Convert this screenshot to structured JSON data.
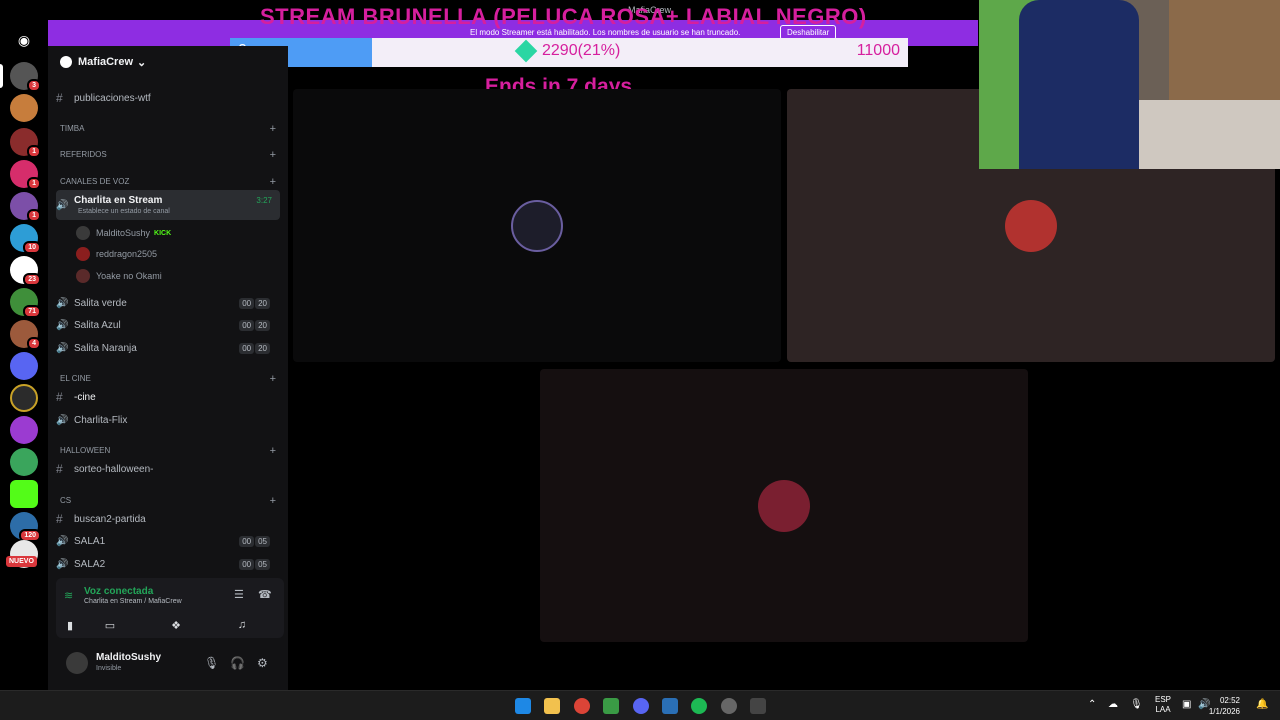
{
  "window": {
    "app_title": "MafiaCrew",
    "stream_title": "STREAM BRUNELLA (PELUCA ROSA+ LABIAL NEGRO)",
    "streamer_notice": "El modo Streamer está habilitado. Los nombres de usuario se han truncado.",
    "disable_label": "Deshabilitar"
  },
  "goal": {
    "min": "0",
    "max": "11000",
    "current": "2290(21%)",
    "progress_fraction": 0.21,
    "ends": "Ends in 7 days",
    "colors": {
      "fill": "#4e9cf5",
      "text": "#d61f9e",
      "gem": "#2ad6a3"
    }
  },
  "server": {
    "name": "MafiaCrew",
    "rail_badges": [
      "3",
      "1",
      "1",
      "1",
      "10",
      "23",
      "71",
      "4",
      "120"
    ],
    "nuevo_label": "NUEVO"
  },
  "sidebar": {
    "channels": {
      "publicaciones": "publicaciones-wtf",
      "cat_timba": "TIMBA",
      "cat_referidos": "REFERIDOS",
      "cat_voz": "Canales de voz",
      "charlita": "Charlita en Stream",
      "charlita_time": "3:27",
      "charlita_status": "Establece un estado de canal",
      "salita_verde": "Salita verde",
      "salita_azul": "Salita Azul",
      "salita_naranja": "Salita Naranja",
      "cat_cine": "El Cine",
      "cine": "-cine",
      "charlita_flix": "Charlita-Flix",
      "cat_halloween": "HALLOWEEN",
      "sorteo": "sorteo-halloween-",
      "cat_cs": "CS",
      "buscan2": "buscan2-partida",
      "sala1": "SALA1",
      "sala2": "SALA2"
    },
    "counts": {
      "salita_verde": [
        "00",
        "20"
      ],
      "salita_azul": [
        "00",
        "20"
      ],
      "salita_naranja": [
        "00",
        "20"
      ],
      "sala1": [
        "00",
        "05"
      ],
      "sala2": [
        "00",
        "05"
      ]
    },
    "voice_users": [
      {
        "name": "MalditoSushy",
        "tag": "KICK"
      },
      {
        "name": "reddragon2505"
      },
      {
        "name": "Yoake no Okami"
      }
    ]
  },
  "voice_panel": {
    "status": "Voz conectada",
    "location": "Charlita en Stream / MafiaCrew"
  },
  "user": {
    "name": "MalditoSushy",
    "status": "Invisible"
  },
  "taskbar": {
    "lang": "ESP",
    "layout": "LAA",
    "time": "02:52",
    "date": "1/1/2026"
  }
}
